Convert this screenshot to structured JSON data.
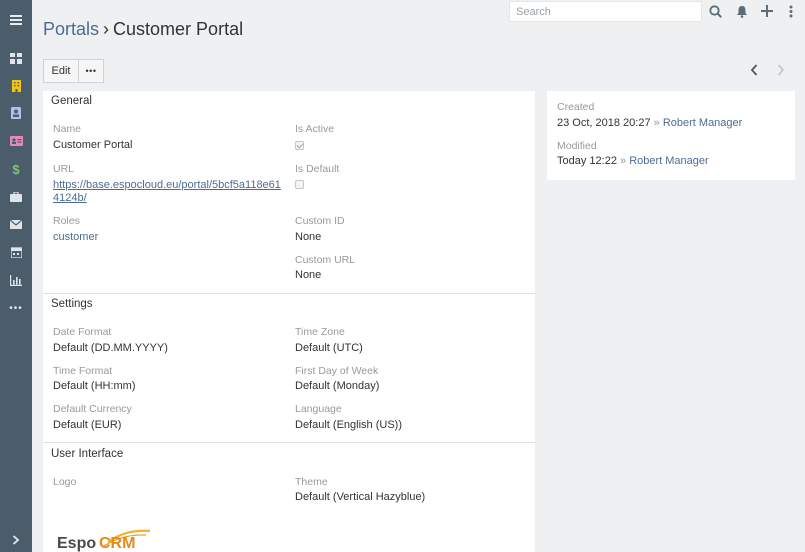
{
  "topbar": {
    "search_placeholder": "Search"
  },
  "header": {
    "breadcrumb_root": "Portals",
    "breadcrumb_separator": "›",
    "title": "Customer Portal"
  },
  "actions": {
    "edit_label": "Edit",
    "more_label": "•••"
  },
  "general": {
    "heading": "General",
    "name_label": "Name",
    "name_value": "Customer Portal",
    "url_label": "URL",
    "url_value": "https://base.espocloud.eu/portal/5bcf5a118e614124b/",
    "roles_label": "Roles",
    "roles_value": "customer",
    "is_active_label": "Is Active",
    "is_active_checked": true,
    "is_default_label": "Is Default",
    "is_default_checked": false,
    "custom_id_label": "Custom ID",
    "custom_id_value": "None",
    "custom_url_label": "Custom URL",
    "custom_url_value": "None"
  },
  "settings": {
    "heading": "Settings",
    "date_format_label": "Date Format",
    "date_format_value": "Default (DD.MM.YYYY)",
    "time_zone_label": "Time Zone",
    "time_zone_value": "Default (UTC)",
    "time_format_label": "Time Format",
    "time_format_value": "Default (HH:mm)",
    "first_day_label": "First Day of Week",
    "first_day_value": "Default (Monday)",
    "currency_label": "Default Currency",
    "currency_value": "Default (EUR)",
    "language_label": "Language",
    "language_value": "Default (English (US))"
  },
  "ui": {
    "heading": "User Interface",
    "logo_label": "Logo",
    "theme_label": "Theme",
    "theme_value": "Default (Vertical Hazyblue)",
    "logo_text": "EspoCRM"
  },
  "side": {
    "created_label": "Created",
    "created_value": "23 Oct, 2018 20:27",
    "created_sep": "»",
    "created_by": "Robert Manager",
    "modified_label": "Modified",
    "modified_value": "Today 12:22",
    "modified_sep": "»",
    "modified_by": "Robert Manager"
  },
  "sidebar": {
    "items": [
      "menu-icon",
      "dashboard-icon",
      "building-icon",
      "contact-icon",
      "lead-card-icon",
      "dollar-icon",
      "briefcase-icon",
      "envelope-icon",
      "calendar-icon",
      "report-icon",
      "more-icon",
      "collapse-icon"
    ]
  },
  "colors": {
    "sidebar": "#4b5c6a",
    "link": "#4c6c95",
    "accent_yellow": "#f1c40f",
    "accent_green": "#7cc576",
    "accent_pink": "#e48ab8"
  }
}
